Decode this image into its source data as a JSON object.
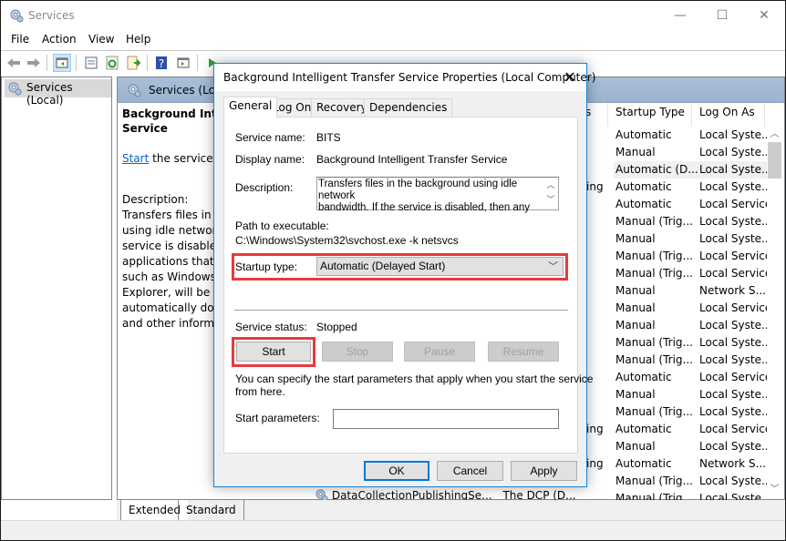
{
  "window": {
    "title": "Services",
    "controls": {
      "minimize": "—",
      "maximize": "☐",
      "close": "✕"
    }
  },
  "menu": [
    "File",
    "Action",
    "View",
    "Help"
  ],
  "toolbar": {
    "icons": [
      "back-icon",
      "forward-icon",
      "show-hide-console-tree-icon",
      "properties-icon",
      "refresh-icon",
      "export-list-icon",
      "help-icon",
      "show-action-pane-icon",
      "start-service-icon",
      "stop-service-icon",
      "pause-service-icon",
      "restart-service-icon"
    ]
  },
  "tree": {
    "root": "Services (Local)"
  },
  "right_pane": {
    "header": "Services (Local)",
    "extended": {
      "service_title": "Background Intelligent Transfer Service",
      "service_title_line1": "Background Intelli",
      "service_title_line2": "Service",
      "start_link": "Start",
      "start_suffix": " the service",
      "description_label": "Description:",
      "description_lines": [
        "Transfers files in the",
        "using idle network",
        "service is disabled, t",
        "applications that de",
        "such as Windows U",
        "Explorer, will be una",
        "automatically down",
        "and other informat"
      ]
    },
    "columns": {
      "status_partial": "s",
      "startup_type": "Startup Type",
      "log_on_as": "Log On As"
    },
    "rows": [
      {
        "status_frag": "",
        "startup": "Automatic",
        "logon": "Local Syste..."
      },
      {
        "status_frag": "",
        "startup": "Manual",
        "logon": "Local Syste..."
      },
      {
        "status_frag": "",
        "startup": "Automatic (D...",
        "logon": "Local Syste...",
        "selected": true
      },
      {
        "status_frag": "ing",
        "startup": "Automatic",
        "logon": "Local Syste..."
      },
      {
        "status_frag": "",
        "startup": "Automatic",
        "logon": "Local Service"
      },
      {
        "status_frag": "",
        "startup": "Manual (Trig...",
        "logon": "Local Syste..."
      },
      {
        "status_frag": "",
        "startup": "Manual",
        "logon": "Local Syste..."
      },
      {
        "status_frag": "",
        "startup": "Manual (Trig...",
        "logon": "Local Service"
      },
      {
        "status_frag": "",
        "startup": "Manual (Trig...",
        "logon": "Local Service"
      },
      {
        "status_frag": "",
        "startup": "Manual",
        "logon": "Network S..."
      },
      {
        "status_frag": "",
        "startup": "Manual",
        "logon": "Local Service"
      },
      {
        "status_frag": "",
        "startup": "Manual",
        "logon": "Local Syste..."
      },
      {
        "status_frag": "",
        "startup": "Manual (Trig...",
        "logon": "Local Syste..."
      },
      {
        "status_frag": "",
        "startup": "Manual (Trig...",
        "logon": "Local Syste..."
      },
      {
        "status_frag": "",
        "startup": "Automatic",
        "logon": "Local Service"
      },
      {
        "status_frag": "",
        "startup": "Manual",
        "logon": "Local Syste..."
      },
      {
        "status_frag": "",
        "startup": "Manual (Trig...",
        "logon": "Local Syste..."
      },
      {
        "status_frag": "ing",
        "startup": "Automatic",
        "logon": "Local Service"
      },
      {
        "status_frag": "",
        "startup": "Manual",
        "logon": "Local Syste..."
      },
      {
        "status_frag": "ing",
        "startup": "Automatic",
        "logon": "Network S..."
      },
      {
        "status_frag": "",
        "startup": "Manual (Trig...",
        "logon": "Local Syste..."
      },
      {
        "status_frag": "",
        "startup": "Manual (Trig...",
        "logon": "Local Syste..."
      }
    ],
    "partial_row": {
      "name": "DataCollectionPublishingSe...",
      "description": "The DCP (D..."
    },
    "bottom_tabs": [
      "Extended",
      "Standard"
    ]
  },
  "dialog": {
    "title": "Background Intelligent Transfer Service Properties (Local Computer)",
    "close": "✕",
    "tabs": [
      "General",
      "Log On",
      "Recovery",
      "Dependencies"
    ],
    "active_tab": "General",
    "service_name_label": "Service name:",
    "service_name": "BITS",
    "display_name_label": "Display name:",
    "display_name": "Background Intelligent Transfer Service",
    "description_label": "Description:",
    "description_line1": "Transfers files in the background using idle network",
    "description_line2": "bandwidth. If the service is disabled, then any",
    "path_label": "Path to executable:",
    "path": "C:\\Windows\\System32\\svchost.exe -k netsvcs",
    "startup_type_label": "Startup type:",
    "startup_type": "Automatic (Delayed Start)",
    "status_label": "Service status:",
    "status": "Stopped",
    "buttons": {
      "start": "Start",
      "stop": "Stop",
      "pause": "Pause",
      "resume": "Resume"
    },
    "hint": "You can specify the start parameters that apply when you start the service from here.",
    "hint_line1": "You can specify the start parameters that apply when you start the service",
    "hint_line2": "from here.",
    "start_params_label": "Start parameters:",
    "start_params_value": "",
    "footer": {
      "ok": "OK",
      "cancel": "Cancel",
      "apply": "Apply"
    }
  },
  "colors": {
    "highlight": "#e63a3e",
    "accent": "#0078d7",
    "link": "#0066cc"
  }
}
